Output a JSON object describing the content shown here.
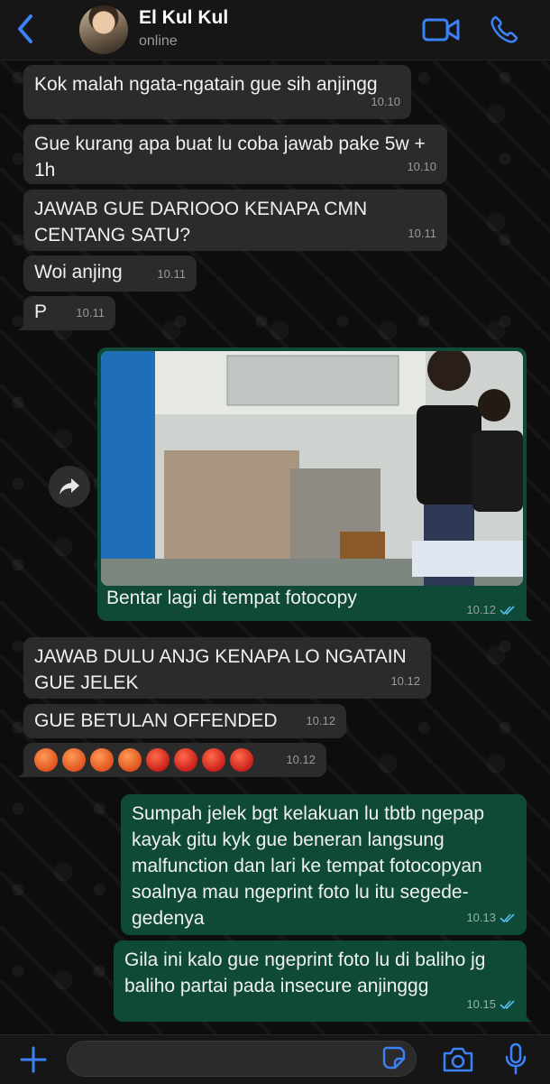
{
  "header": {
    "back_label": "Back",
    "contact_name": "El Kul Kul",
    "status": "online",
    "accent": "#3b82f6"
  },
  "messages": [
    {
      "direction": "in",
      "text": "Kok malah ngata-ngatain gue sih anjingg",
      "time": "10.10"
    },
    {
      "direction": "in",
      "text": "Gue kurang apa buat lu coba jawab pake 5w + 1h",
      "time": "10.10"
    },
    {
      "direction": "in",
      "text": "JAWAB GUE DARIOOO KENAPA CMN CENTANG SATU?",
      "time": "10.11"
    },
    {
      "direction": "in",
      "text": "Woi anjing",
      "time": "10.11"
    },
    {
      "direction": "in",
      "text": "P",
      "time": "10.11"
    },
    {
      "direction": "out",
      "type": "image",
      "caption": "Bentar lagi di tempat fotocopy",
      "time": "10.12",
      "read": true
    },
    {
      "direction": "in",
      "text": "JAWAB DULU ANJG KENAPA LO NGATAIN GUE JELEK",
      "time": "10.12"
    },
    {
      "direction": "in",
      "text": "GUE BETULAN OFFENDED",
      "time": "10.12"
    },
    {
      "direction": "in",
      "type": "emoji",
      "emojis": [
        "angry-face",
        "angry-face",
        "angry-face",
        "angry-face",
        "cursing-face",
        "cursing-face",
        "cursing-face",
        "cursing-face"
      ],
      "time": "10.12"
    },
    {
      "direction": "out",
      "text": "Sumpah jelek bgt kelakuan lu tbtb ngepap kayak gitu kyk gue beneran langsung malfunction dan lari ke tempat fotocopyan soalnya mau ngeprint foto lu itu segede-gedenya",
      "time": "10.13",
      "read": true
    },
    {
      "direction": "out",
      "text": "Gila ini kalo gue ngeprint foto lu di baliho jg baliho partai pada insecure anjinggg",
      "time": "10.15",
      "read": true
    }
  ],
  "colors": {
    "incoming_bubble": "#2b2b2b",
    "outgoing_bubble": "#0f4a38",
    "read_tick": "#53bdeb"
  }
}
